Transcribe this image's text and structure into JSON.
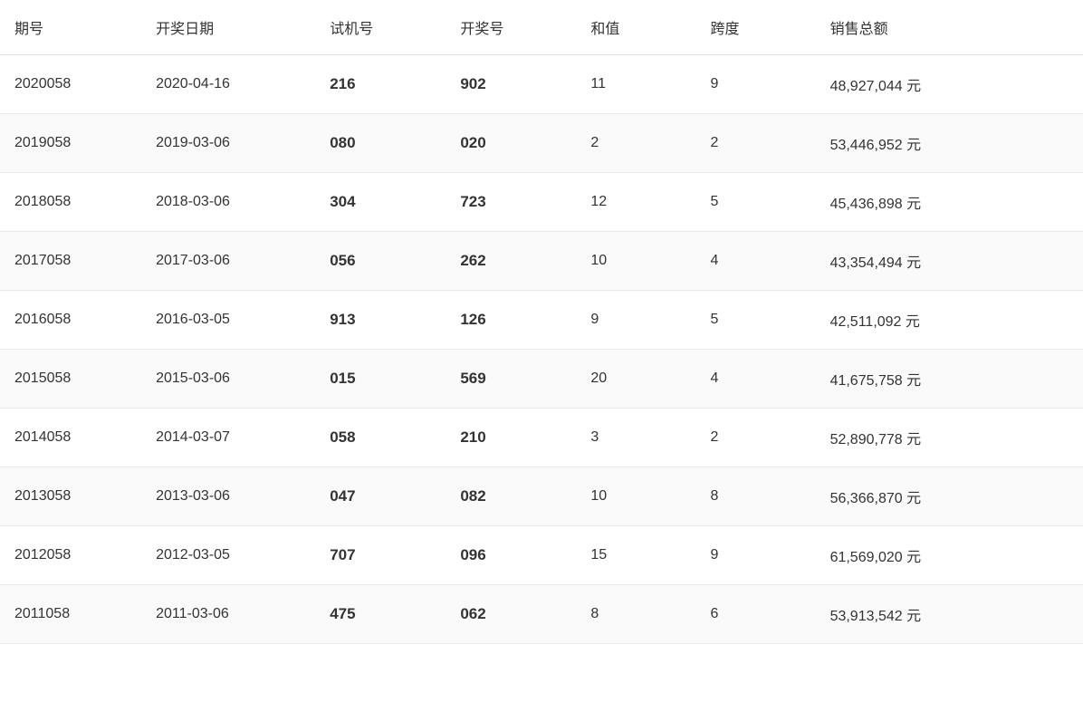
{
  "table": {
    "headers": [
      "期号",
      "开奖日期",
      "试机号",
      "开奖号",
      "和值",
      "跨度",
      "销售总额"
    ],
    "rows": [
      {
        "qihao": "2020058",
        "date": "2020-04-16",
        "shiji": "216",
        "kaijang": "902",
        "hezhi": "11",
        "kuadu": "9",
        "xiaoshou": "48,927,044 元"
      },
      {
        "qihao": "2019058",
        "date": "2019-03-06",
        "shiji": "080",
        "kaijang": "020",
        "hezhi": "2",
        "kuadu": "2",
        "xiaoshou": "53,446,952 元"
      },
      {
        "qihao": "2018058",
        "date": "2018-03-06",
        "shiji": "304",
        "kaijang": "723",
        "hezhi": "12",
        "kuadu": "5",
        "xiaoshou": "45,436,898 元"
      },
      {
        "qihao": "2017058",
        "date": "2017-03-06",
        "shiji": "056",
        "kaijang": "262",
        "hezhi": "10",
        "kuadu": "4",
        "xiaoshou": "43,354,494 元"
      },
      {
        "qihao": "2016058",
        "date": "2016-03-05",
        "shiji": "913",
        "kaijang": "126",
        "hezhi": "9",
        "kuadu": "5",
        "xiaoshou": "42,511,092 元"
      },
      {
        "qihao": "2015058",
        "date": "2015-03-06",
        "shiji": "015",
        "kaijang": "569",
        "hezhi": "20",
        "kuadu": "4",
        "xiaoshou": "41,675,758 元"
      },
      {
        "qihao": "2014058",
        "date": "2014-03-07",
        "shiji": "058",
        "kaijang": "210",
        "hezhi": "3",
        "kuadu": "2",
        "xiaoshou": "52,890,778 元"
      },
      {
        "qihao": "2013058",
        "date": "2013-03-06",
        "shiji": "047",
        "kaijang": "082",
        "hezhi": "10",
        "kuadu": "8",
        "xiaoshou": "56,366,870 元"
      },
      {
        "qihao": "2012058",
        "date": "2012-03-05",
        "shiji": "707",
        "kaijang": "096",
        "hezhi": "15",
        "kuadu": "9",
        "xiaoshou": "61,569,020 元"
      },
      {
        "qihao": "2011058",
        "date": "2011-03-06",
        "shiji": "475",
        "kaijang": "062",
        "hezhi": "8",
        "kuadu": "6",
        "xiaoshou": "53,913,542 元"
      }
    ]
  }
}
